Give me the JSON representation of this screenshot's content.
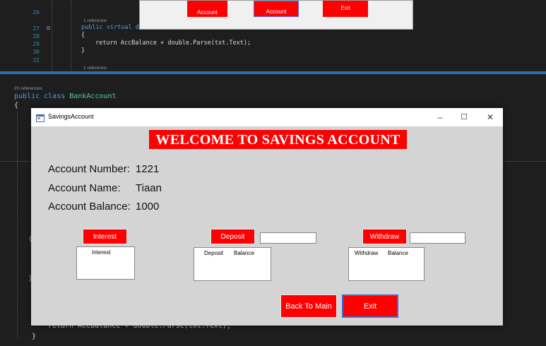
{
  "editor": {
    "lines_top": [
      {
        "num": "26",
        "text": ""
      },
      {
        "num": "27",
        "text": "public virtual double"
      },
      {
        "num": "28",
        "text": "{"
      },
      {
        "num": "29",
        "text": "return AccBalance + double.Parse(txt.Text);"
      },
      {
        "num": "30",
        "text": "}"
      },
      {
        "num": "31",
        "text": ""
      }
    ],
    "ref_top_1": "1 reference",
    "ref_top_2": "1 reference",
    "ref_class": "20 references",
    "class_decl_kw": "public class ",
    "class_decl_name": "BankAccount",
    "brace_open": "{",
    "bottom_line": "return AccBalance + double.Parse(txt.Text);",
    "brace_close": "}"
  },
  "background_dialog": {
    "buttons": [
      "Account",
      "Account",
      "Exit"
    ]
  },
  "window": {
    "title": "SavingsAccount",
    "controls": {
      "minimize": "–",
      "maximize": "☐",
      "close": "✕"
    },
    "banner": "WELCOME TO SAVINGS ACCOUNT",
    "account_number_label": "Account Number:",
    "account_number_value": "1221",
    "account_name_label": "Account Name:",
    "account_name_value": "Tiaan",
    "account_balance_label": "Account Balance:",
    "account_balance_value": "1000",
    "interest_button": "Interest",
    "interest_list_header": "Interest",
    "deposit_button": "Deposit",
    "deposit_input": "",
    "deposit_list_headers": [
      "Deposit",
      "Balance"
    ],
    "withdraw_button": "Withdraw",
    "withdraw_input": "",
    "withdraw_list_headers": [
      "Withdraw",
      "Balance"
    ],
    "back_button": "Back To Main",
    "exit_button": "Exit"
  }
}
